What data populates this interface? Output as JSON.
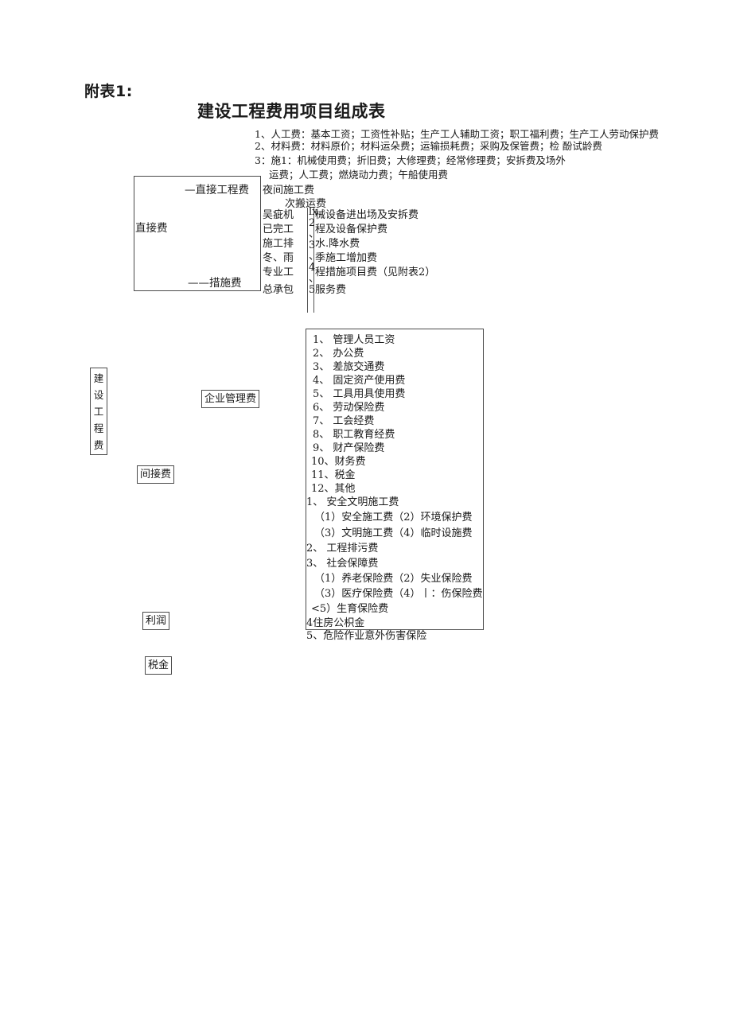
{
  "header": {
    "attachment_label": "附表1:",
    "title": "建设工程费用项目组成表"
  },
  "top_definitions": [
    "1、人工费：基本工资；工资性补贴；生产工人辅助工资；职工福利费；生产工人劳动保护费",
    "2、材料费：材料原价；材料运朵费；运输损耗费；采购及保管费；检 酚试龄费",
    "3：施1：机械使用费；折旧费；大修理费；经常修理费；安拆费及场外",
    "运费；人工费；燃烧动力费；午船使用费"
  ],
  "direct_cost_box": {
    "label": "直接费",
    "top_item": "—直接工程费",
    "bottom_item": "——措施费"
  },
  "measure_column": {
    "night_work": "夜间施工费",
    "secondary_transport": "次搬运费",
    "numerals": [
      "lx",
      "2",
      "、",
      "3",
      "、",
      "4",
      "、",
      "5"
    ],
    "rows": [
      {
        "left": "吴疵机",
        "right": "械设备进出场及安拆费"
      },
      {
        "left": "已完工",
        "right": "程及设备保护费"
      },
      {
        "left": "施工排",
        "right": "水.降水费"
      },
      {
        "left": "冬、雨",
        "right": "季施工增加费"
      },
      {
        "left": "专业工",
        "right": "程措施项目费（见附表2）"
      },
      {
        "left": "总承包",
        "right": "服务费"
      }
    ]
  },
  "project_cost_box": {
    "chars": [
      "建",
      "设",
      "工",
      "程",
      "费"
    ]
  },
  "flow_boxes": {
    "enterprise_management": "企业管理费",
    "indirect_cost": "间接费",
    "profit": "利润",
    "tax": "税金"
  },
  "detail_box": {
    "management_items": [
      "1、 管理人员工资",
      "2、 办公费",
      "3、 差旅交通费",
      "4、 固定资产使用费",
      "5、 工具用具使用费",
      "6、 劳动保险费",
      "7、 工会经费",
      "8、 职工教育经费",
      "9、 财产保险费",
      "10、财务费",
      "11、税金",
      "12、其他"
    ],
    "fee_items": [
      "1、 安全文明施工费",
      "（1）安全施工费（2）环境保护费",
      "（3）文明施工费（4）临时设施费",
      "2、 工程排污费",
      "3、 社会保障费",
      "（1）养老保险费（2）失业保险费",
      "（3）医疗保险费（4）丨：伤保险费",
      "<5）生育保险费",
      "4住房公枳金",
      "5、危险作业意外伤害保险"
    ]
  }
}
